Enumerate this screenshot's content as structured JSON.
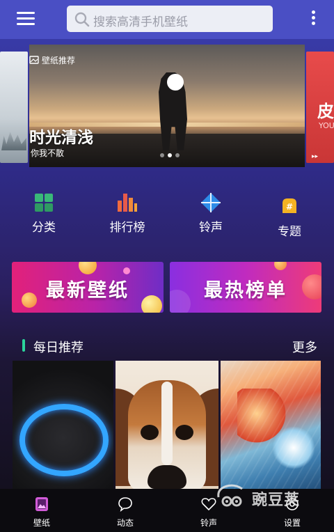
{
  "header": {
    "search_placeholder": "搜索高清手机壁纸"
  },
  "banner": {
    "tag": "壁纸推荐",
    "title": "时光清浅",
    "subtitle": "你我不散",
    "right_card": {
      "title": "皮",
      "sub": "YOU",
      "arrow": "▸▸"
    },
    "dots_count": 3,
    "active_dot": 1
  },
  "categories": [
    {
      "label": "分类",
      "icon": "grid-icon"
    },
    {
      "label": "排行榜",
      "icon": "bar-chart-icon"
    },
    {
      "label": "铃声",
      "icon": "diamond-icon"
    },
    {
      "label": "专题",
      "icon": "hashtag-icon"
    }
  ],
  "promos": [
    {
      "label": "最新壁纸"
    },
    {
      "label": "最热榜单"
    }
  ],
  "daily": {
    "title": "每日推荐",
    "more": "更多"
  },
  "bottom_nav": [
    {
      "label": "壁纸",
      "icon": "wallpaper-icon",
      "active": true
    },
    {
      "label": "动态",
      "icon": "chat-bubble-icon",
      "active": false
    },
    {
      "label": "铃声",
      "icon": "heart-icon",
      "active": false
    },
    {
      "label": "设置",
      "icon": "settings-icon",
      "active": false
    }
  ],
  "watermark": "豌豆荚",
  "colors": {
    "topbar": "#4a4fc4",
    "accent_green": "#2bd39b",
    "promo_left": "#e3216f",
    "promo_right": "#b92bb8"
  }
}
